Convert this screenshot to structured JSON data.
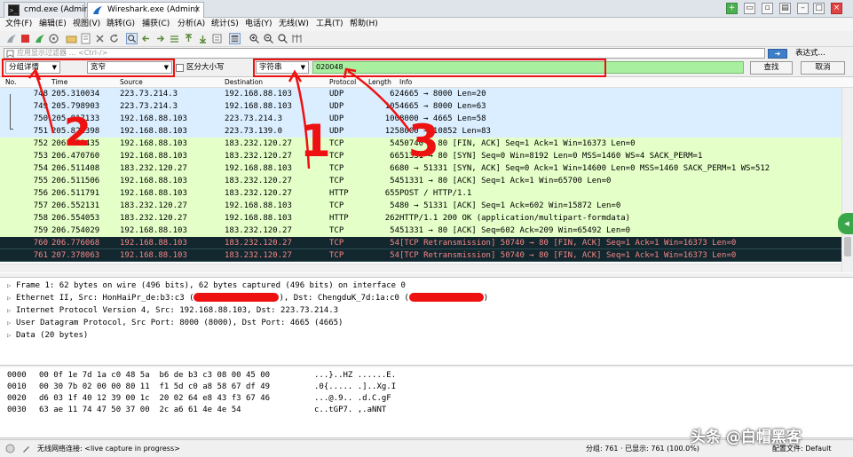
{
  "tabs": [
    {
      "label": "cmd.exe (Admin)",
      "active": false
    },
    {
      "label": "Wireshark.exe (Admin)",
      "active": true
    }
  ],
  "menu": [
    "文件(F)",
    "编辑(E)",
    "视图(V)",
    "跳转(G)",
    "捕获(C)",
    "分析(A)",
    "统计(S)",
    "电话(Y)",
    "无线(W)",
    "工具(T)",
    "帮助(H)"
  ],
  "display_filter": {
    "placeholder": "应用显示过滤器 … <Ctrl-/>",
    "expression_label": "表达式…"
  },
  "find_bar": {
    "search_in": "分组详情",
    "charset": "宽窄",
    "case_label": "区分大小写",
    "search_type": "字符串",
    "search_value": "020048",
    "find_label": "查找",
    "cancel_label": "取消"
  },
  "packet_list": {
    "columns": [
      "No.",
      "Time",
      "Source",
      "Destination",
      "Protocol",
      "Length",
      "Info"
    ],
    "rows": [
      {
        "no": "748",
        "time": "205.310034",
        "src": "223.73.214.3",
        "dst": "192.168.88.103",
        "proto": "UDP",
        "len": "62",
        "info": "4665 → 8000  Len=20",
        "style": "udp"
      },
      {
        "no": "749",
        "time": "205.798903",
        "src": "223.73.214.3",
        "dst": "192.168.88.103",
        "proto": "UDP",
        "len": "105",
        "info": "4665 → 8000  Len=63",
        "style": "udp"
      },
      {
        "no": "750",
        "time": "205.817133",
        "src": "192.168.88.103",
        "dst": "223.73.214.3",
        "proto": "UDP",
        "len": "100",
        "info": "8000 → 4665  Len=58",
        "style": "udp"
      },
      {
        "no": "751",
        "time": "205.822398",
        "src": "192.168.88.103",
        "dst": "223.73.139.0",
        "proto": "UDP",
        "len": "125",
        "info": "8000 → 10852  Len=83",
        "style": "udp"
      },
      {
        "no": "752",
        "time": "206.452435",
        "src": "192.168.88.103",
        "dst": "183.232.120.27",
        "proto": "TCP",
        "len": "54",
        "info": "50740 → 80 [FIN, ACK] Seq=1 Ack=1 Win=16373 Len=0",
        "style": "tcp"
      },
      {
        "no": "753",
        "time": "206.470760",
        "src": "192.168.88.103",
        "dst": "183.232.120.27",
        "proto": "TCP",
        "len": "66",
        "info": "51331 → 80 [SYN] Seq=0 Win=8192 Len=0 MSS=1460 WS=4 SACK_PERM=1",
        "style": "tcp"
      },
      {
        "no": "754",
        "time": "206.511408",
        "src": "183.232.120.27",
        "dst": "192.168.88.103",
        "proto": "TCP",
        "len": "66",
        "info": "80 → 51331 [SYN, ACK] Seq=0 Ack=1 Win=14600 Len=0 MSS=1460 SACK_PERM=1 WS=512",
        "style": "tcp"
      },
      {
        "no": "755",
        "time": "206.511506",
        "src": "192.168.88.103",
        "dst": "183.232.120.27",
        "proto": "TCP",
        "len": "54",
        "info": "51331 → 80 [ACK] Seq=1 Ack=1 Win=65700 Len=0",
        "style": "tcp"
      },
      {
        "no": "756",
        "time": "206.511791",
        "src": "192.168.88.103",
        "dst": "183.232.120.27",
        "proto": "HTTP",
        "len": "655",
        "info": "POST / HTTP/1.1",
        "style": "tcp"
      },
      {
        "no": "757",
        "time": "206.552131",
        "src": "183.232.120.27",
        "dst": "192.168.88.103",
        "proto": "TCP",
        "len": "54",
        "info": "80 → 51331 [ACK] Seq=1 Ack=602 Win=15872 Len=0",
        "style": "tcp"
      },
      {
        "no": "758",
        "time": "206.554053",
        "src": "183.232.120.27",
        "dst": "192.168.88.103",
        "proto": "HTTP",
        "len": "262",
        "info": "HTTP/1.1 200 OK  (application/multipart-formdata)",
        "style": "tcp"
      },
      {
        "no": "759",
        "time": "206.754029",
        "src": "192.168.88.103",
        "dst": "183.232.120.27",
        "proto": "TCP",
        "len": "54",
        "info": "51331 → 80 [ACK] Seq=602 Ack=209 Win=65492 Len=0",
        "style": "tcp"
      },
      {
        "no": "760",
        "time": "206.776068",
        "src": "192.168.88.103",
        "dst": "183.232.120.27",
        "proto": "TCP",
        "len": "54",
        "info": "[TCP Retransmission] 50740 → 80 [FIN, ACK] Seq=1 Ack=1 Win=16373 Len=0",
        "style": "bad"
      },
      {
        "no": "761",
        "time": "207.378063",
        "src": "192.168.88.103",
        "dst": "183.232.120.27",
        "proto": "TCP",
        "len": "54",
        "info": "[TCP Retransmission] 50740 → 80 [FIN, ACK] Seq=1 Ack=1 Win=16373 Len=0",
        "style": "bad"
      }
    ]
  },
  "details": [
    {
      "text": "Frame 1: 62 bytes on wire (496 bits), 62 bytes captured (496 bits) on interface 0"
    },
    {
      "text": "Ethernet II, Src: HonHaiPr_de:b3:c3 (",
      "mid": "), Dst: ChengduK_7d:1a:c0 (",
      "end": ")"
    },
    {
      "text": "Internet Protocol Version 4, Src: 192.168.88.103, Dst: 223.73.214.3"
    },
    {
      "text": "User Datagram Protocol, Src Port: 8000 (8000), Dst Port: 4665 (4665)"
    },
    {
      "text": "Data (20 bytes)"
    }
  ],
  "bytes": [
    {
      "off": "0000",
      "hex": "00 0f 1e 7d 1a c0 48 5a  b6 de b3 c3 08 00 45 00",
      "ascii": "...}..HZ ......E."
    },
    {
      "off": "0010",
      "hex": "00 30 7b 02 00 00 80 11  f1 5d c0 a8 58 67 df 49",
      "ascii": ".0{..... .]..Xg.I"
    },
    {
      "off": "0020",
      "hex": "d6 03 1f 40 12 39 00 1c  20 02 64 e8 43 f3 67 46",
      "ascii": "...@.9.. .d.C.gF"
    },
    {
      "off": "0030",
      "hex": "63 ae 11 74 47 50 37 00  2c a6 61 4e 4e 54",
      "ascii": "c..tGP7. ,.aNNT"
    }
  ],
  "status": {
    "connection": "无线网络连接: <live capture in progress>",
    "packets": "分组: 761 · 已显示: 761 (100.0%)",
    "profile": "配置文件: Default"
  },
  "annotations": [
    "1",
    "2",
    "3"
  ],
  "watermark": "头条 @白帽黑客",
  "colors": {
    "udp_row": "#daeeff",
    "tcp_row": "#e7e6ff",
    "http_row": "#e4ffc7",
    "bad_row_bg": "#12272e",
    "bad_row_fg": "#f78787",
    "annotation": "#ee1111",
    "find_input": "#a8f0a0"
  }
}
